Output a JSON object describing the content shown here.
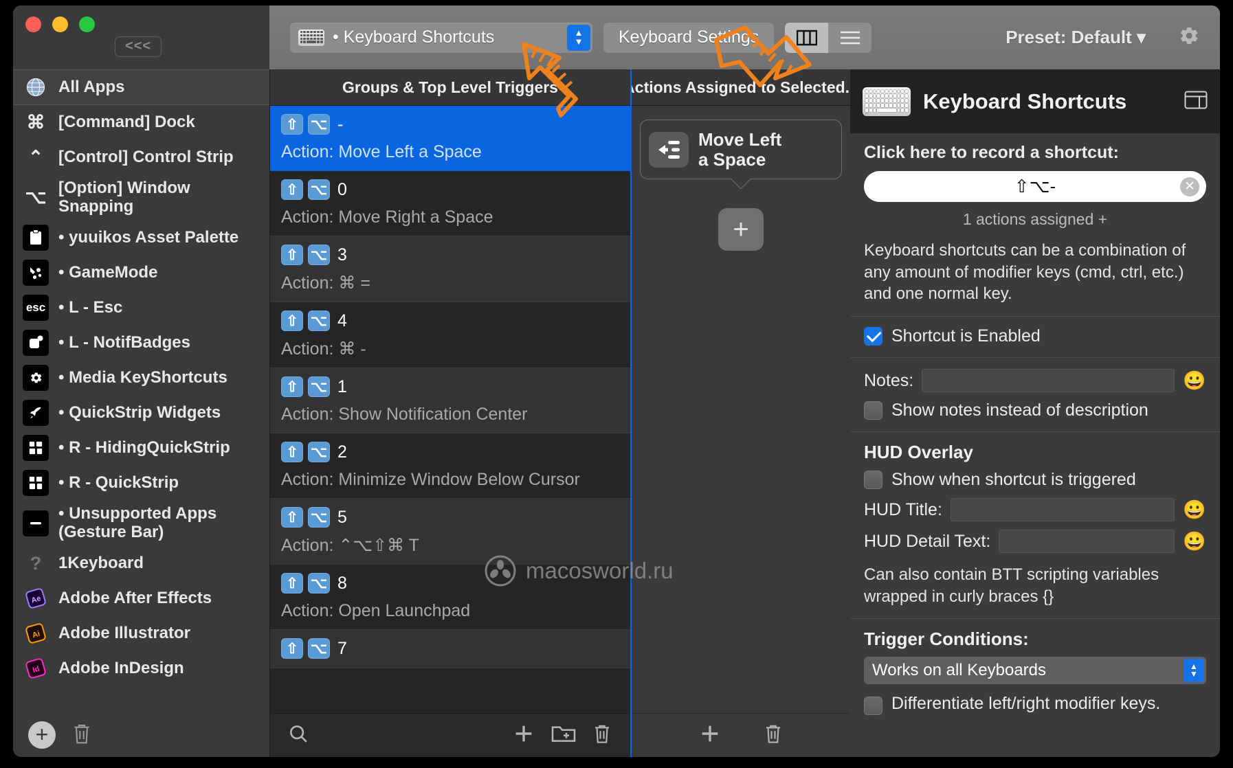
{
  "window": {
    "traffic_lights": [
      "close",
      "minimize",
      "zoom"
    ],
    "collapse_label": "<<<"
  },
  "toolbar": {
    "popup_icon": "keyboard-icon",
    "popup_label": "• Keyboard Shortcuts",
    "settings_button": "Keyboard Settings",
    "view_columns_icon": "columns-view-icon",
    "view_list_icon": "list-view-icon",
    "preset_label": "Preset: Default ▾",
    "gear_icon": "gear-icon"
  },
  "sidebar": {
    "items": [
      {
        "label": "All Apps",
        "icon": "globe-icon",
        "selected": true,
        "bullet": false
      },
      {
        "label": "[Command] Dock",
        "icon": "command-icon",
        "selected": false,
        "bullet": false
      },
      {
        "label": "[Control] Control Strip",
        "icon": "control-icon",
        "selected": false,
        "bullet": false
      },
      {
        "label": "[Option] Window Snapping",
        "icon": "option-icon",
        "selected": false,
        "bullet": false
      },
      {
        "label": "•  yuuikos Asset Palette",
        "icon": "clipboard-icon",
        "selected": false,
        "bullet": true
      },
      {
        "label": "• GameMode",
        "icon": "gamemode-icon",
        "selected": false,
        "bullet": true
      },
      {
        "label": "• L - Esc",
        "icon": "esc-icon",
        "selected": false,
        "bullet": true
      },
      {
        "label": "• L - NotifBadges",
        "icon": "badge-icon",
        "selected": false,
        "bullet": true
      },
      {
        "label": "• Media KeyShortcuts",
        "icon": "gear-icon",
        "selected": false,
        "bullet": true
      },
      {
        "label": "• QuickStrip Widgets",
        "icon": "rocket-icon",
        "selected": false,
        "bullet": true
      },
      {
        "label": "• R - HidingQuickStrip",
        "icon": "grid-icon",
        "selected": false,
        "bullet": true
      },
      {
        "label": "• R - QuickStrip",
        "icon": "grid-icon",
        "selected": false,
        "bullet": true
      },
      {
        "label": "• Unsupported Apps (Gesture Bar)",
        "icon": "gesturebar-icon",
        "selected": false,
        "bullet": true
      },
      {
        "label": "1Keyboard",
        "icon": "question-icon",
        "selected": false,
        "bullet": false
      },
      {
        "label": "Adobe After Effects",
        "icon": "after-effects-icon",
        "selected": false,
        "bullet": false
      },
      {
        "label": "Adobe Illustrator",
        "icon": "illustrator-icon",
        "selected": false,
        "bullet": false
      },
      {
        "label": "Adobe InDesign",
        "icon": "indesign-icon",
        "selected": false,
        "bullet": false
      }
    ],
    "add_icon": "plus-circle-icon",
    "delete_icon": "trash-icon"
  },
  "triggers": {
    "header": "Groups & Top Level Triggers",
    "rows": [
      {
        "keys": [
          "⇧",
          "⌥"
        ],
        "trigger": "-",
        "action": "Action: Move Left a Space",
        "selected": true
      },
      {
        "keys": [
          "⇧",
          "⌥"
        ],
        "trigger": "0",
        "action": "Action: Move Right a Space",
        "selected": false
      },
      {
        "keys": [
          "⇧",
          "⌥"
        ],
        "trigger": "3",
        "action": "Action: ⌘ =",
        "selected": false
      },
      {
        "keys": [
          "⇧",
          "⌥"
        ],
        "trigger": "4",
        "action": "Action: ⌘ -",
        "selected": false
      },
      {
        "keys": [
          "⇧",
          "⌥"
        ],
        "trigger": "1",
        "action": "Action: Show Notification Center",
        "selected": false
      },
      {
        "keys": [
          "⇧",
          "⌥"
        ],
        "trigger": "2",
        "action": "Action: Minimize Window Below Cursor",
        "selected": false
      },
      {
        "keys": [
          "⇧",
          "⌥"
        ],
        "trigger": "5",
        "action": "Action: ⌃⌥⇧⌘ T",
        "selected": false
      },
      {
        "keys": [
          "⇧",
          "⌥"
        ],
        "trigger": "8",
        "action": "Action: Open Launchpad",
        "selected": false
      },
      {
        "keys": [
          "⇧",
          "⌥"
        ],
        "trigger": "7",
        "action": "",
        "selected": false
      }
    ],
    "search_icon": "search-icon",
    "add_icon": "plus-icon",
    "new_group_icon": "new-folder-icon",
    "delete_icon": "trash-icon"
  },
  "actions": {
    "header": "Actions Assigned to Selected...",
    "card_title": "Move Left\na Space",
    "card_icon": "move-left-space-icon",
    "add_button": "+",
    "add_icon": "plus-icon",
    "delete_icon": "trash-icon"
  },
  "config": {
    "title": "Keyboard Shortcuts",
    "title_icon": "keyboard-icon",
    "panes_icon": "panes-icon",
    "record_label": "Click here to record a shortcut:",
    "record_value": "⇧⌥-",
    "clear_icon": "clear-icon",
    "assigned_text": "1 actions assigned +",
    "description": "Keyboard shortcuts can be a combination of any amount of modifier keys (cmd, ctrl, etc.) and one normal key.",
    "shortcut_enabled_label": "Shortcut is Enabled",
    "shortcut_enabled": true,
    "notes_label": "Notes:",
    "notes_value": "",
    "show_notes_label": "Show notes instead of description",
    "show_notes_checked": false,
    "hud_section_title": "HUD Overlay",
    "hud_show_label": "Show when shortcut is triggered",
    "hud_show_checked": false,
    "hud_title_label": "HUD Title:",
    "hud_title_value": "",
    "hud_detail_label": "HUD Detail Text:",
    "hud_detail_value": "",
    "hud_note": "Can also contain BTT scripting variables wrapped in curly braces {}",
    "trigger_conditions_title": "Trigger Conditions:",
    "keyboard_scope_value": "Works on all Keyboards",
    "differentiate_label": "Differentiate left/right modifier keys.",
    "differentiate_checked": false,
    "emoji_icon": "grinning-face-icon"
  },
  "watermark": {
    "text": "macosworld.ru",
    "icon": "watermark-logo-icon"
  },
  "colors": {
    "accent_blue": "#0a66e0",
    "selection_blue": "#1473e6",
    "annotation_orange": "#f0821e",
    "window_bg": "#3a3a3a",
    "panel_bg": "#3b3b3b"
  }
}
